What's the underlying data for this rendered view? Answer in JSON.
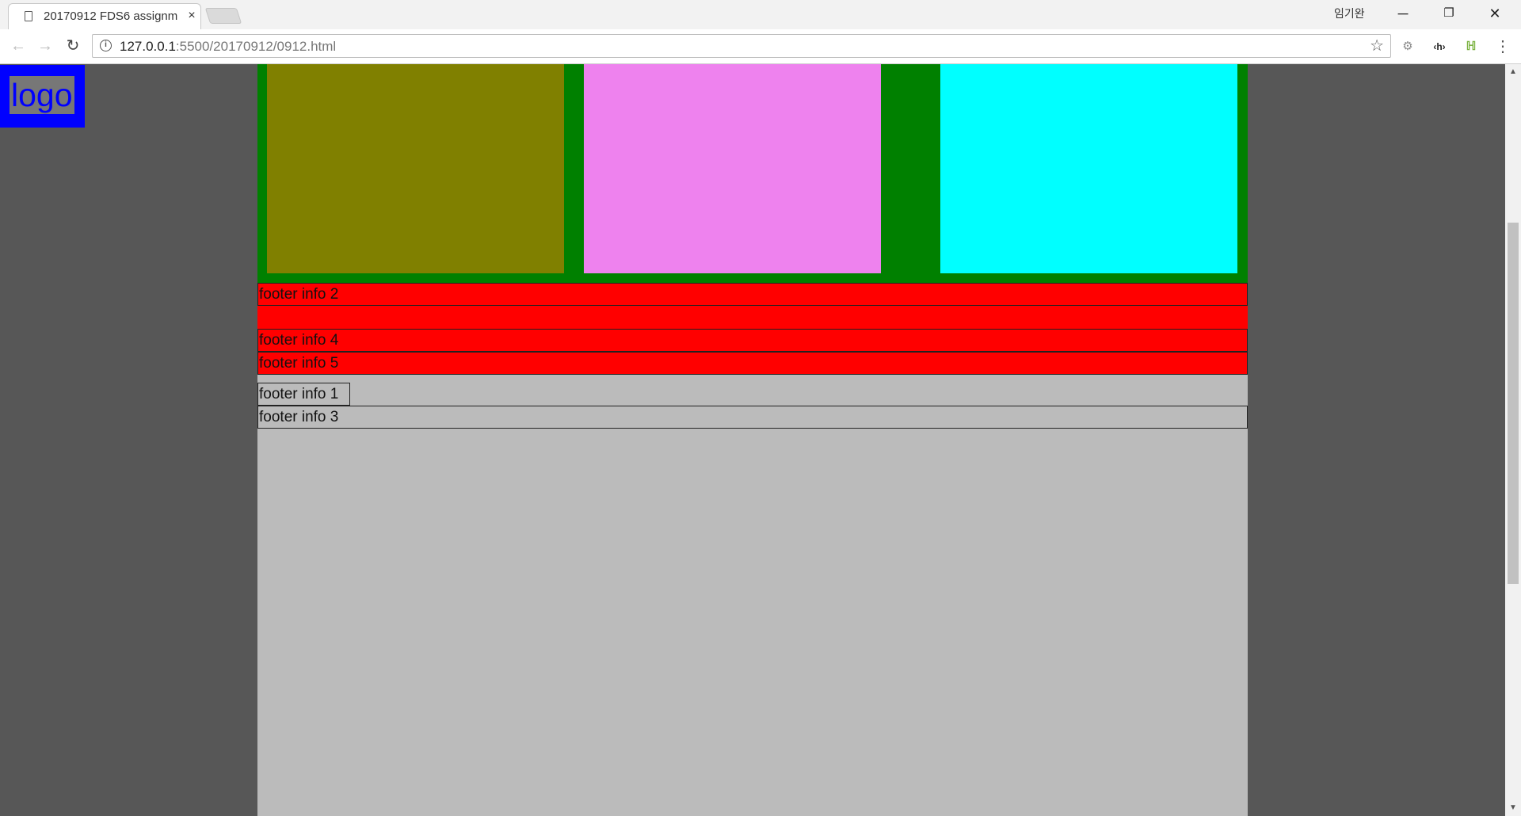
{
  "browser": {
    "tab_title": "20170912 FDS6 assignm",
    "tab_close": "×",
    "user_name": "임기완",
    "window_controls": {
      "minimize": "─",
      "restore": "❐",
      "close": "✕"
    },
    "nav": {
      "back": "←",
      "forward": "→",
      "reload": "↻"
    },
    "url_host": "127.0.0.1",
    "url_rest": ":5500/20170912/0912.html",
    "bookmark_star": "☆",
    "extensions": [
      "gear-extension",
      "html-extension",
      "ladder-extension"
    ],
    "menu": "⋮"
  },
  "page": {
    "logo_text": "logo",
    "colors": {
      "background": "#575757",
      "logo_box": "#0000ff",
      "logo_text_bg": "#777777",
      "container": "#bbbbbb",
      "band": "#008000",
      "tile_1": "#808000",
      "tile_2": "#ee82ee",
      "tile_3": "#00ffff",
      "footer_red": "#ff0000"
    },
    "red_rows": [
      "footer info 2",
      "",
      "footer info 4",
      "footer info 5"
    ],
    "grey_rows": [
      "footer info 1",
      "footer info 3"
    ]
  }
}
